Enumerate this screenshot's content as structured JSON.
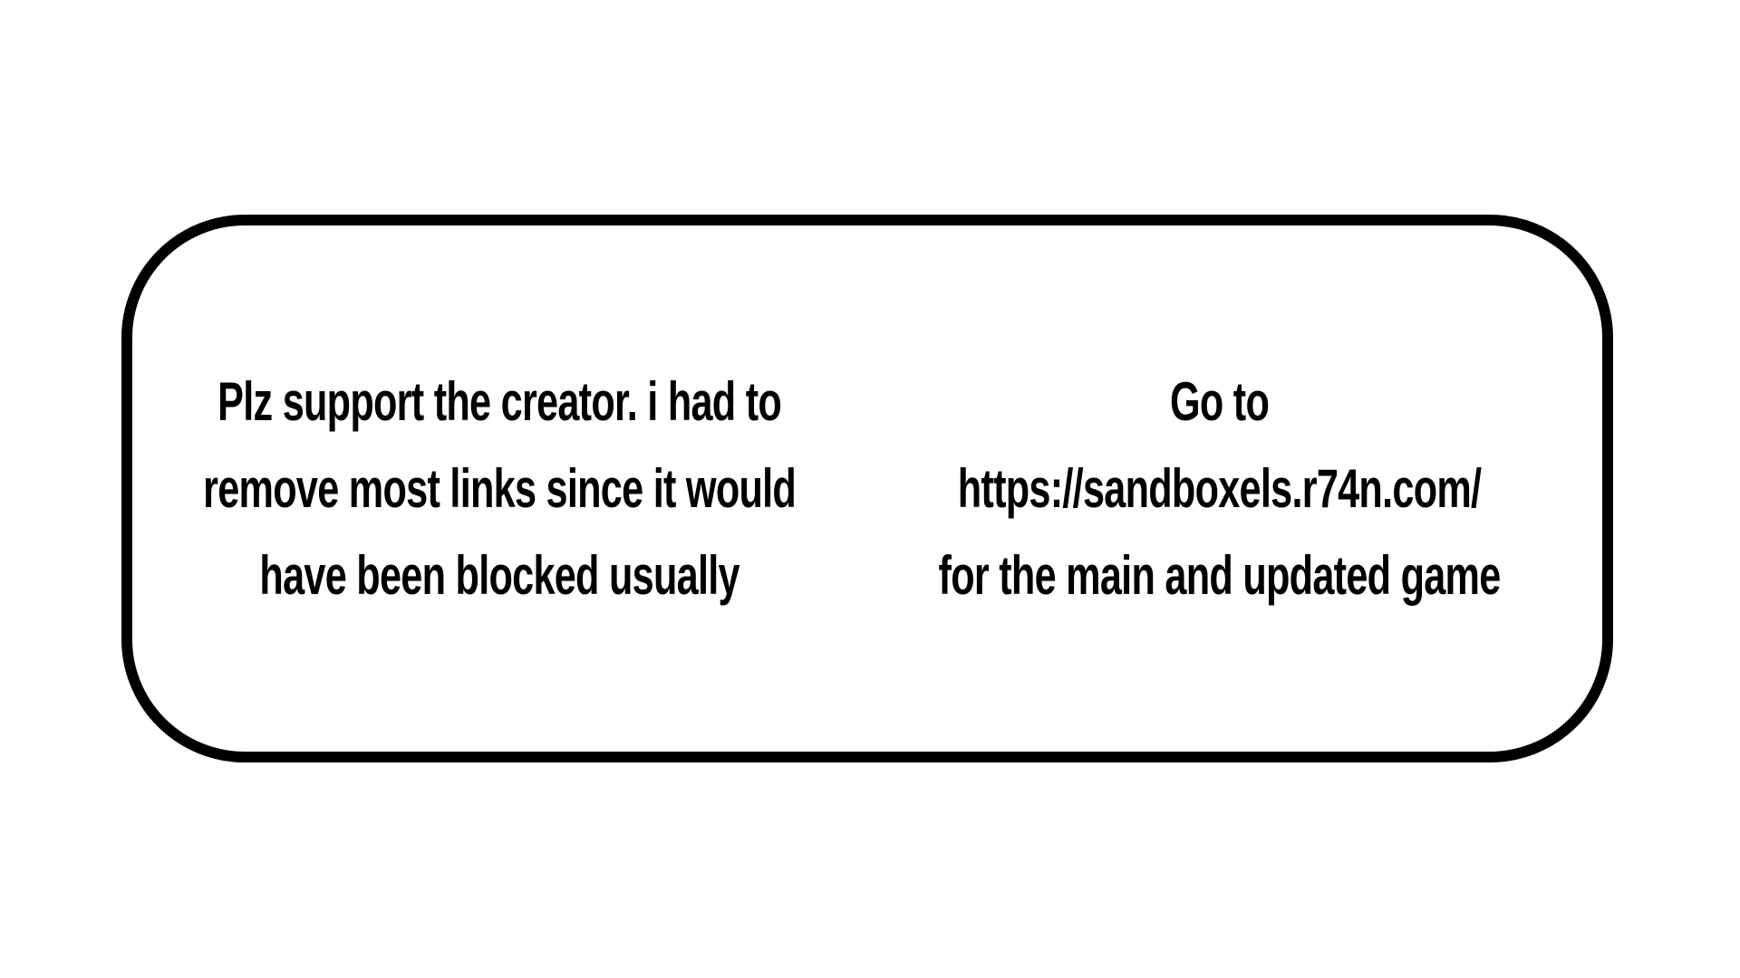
{
  "notice": {
    "left_lines": [
      "Plz support the creator. i had to",
      "remove most links since it would",
      "have been blocked usually"
    ],
    "right_lines": [
      "Go to",
      "https://sandboxels.r74n.com/",
      "for the main and updated game"
    ]
  },
  "colors": {
    "background": "#ffffff",
    "text": "#000000",
    "border": "#000000"
  }
}
